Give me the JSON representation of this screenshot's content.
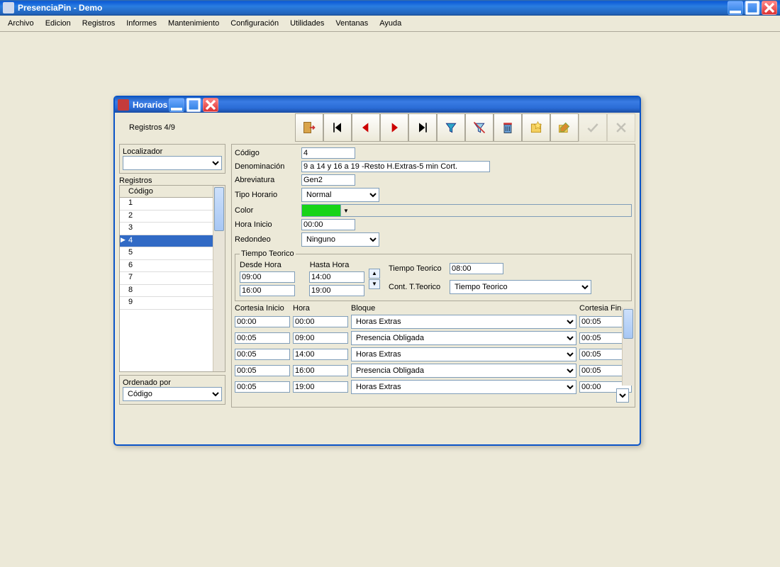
{
  "app": {
    "title": "PresenciaPin - Demo"
  },
  "menubar": [
    "Archivo",
    "Edicion",
    "Registros",
    "Informes",
    "Mantenimiento",
    "Configuración",
    "Utilidades",
    "Ventanas",
    "Ayuda"
  ],
  "dialog": {
    "title": "Horarios",
    "record_counter": "Registros 4/9",
    "toolbar": [
      {
        "name": "exit-icon",
        "title": "Salir"
      },
      {
        "name": "first-icon",
        "title": "Primero"
      },
      {
        "name": "prev-icon",
        "title": "Anterior"
      },
      {
        "name": "next-icon",
        "title": "Siguiente"
      },
      {
        "name": "last-icon",
        "title": "Último"
      },
      {
        "name": "filter-icon",
        "title": "Filtro"
      },
      {
        "name": "clear-filter-icon",
        "title": "Quitar filtro"
      },
      {
        "name": "delete-icon",
        "title": "Eliminar"
      },
      {
        "name": "new-icon",
        "title": "Nuevo"
      },
      {
        "name": "edit-icon",
        "title": "Editar"
      },
      {
        "name": "confirm-icon",
        "title": "Confirmar",
        "disabled": true
      },
      {
        "name": "cancel-icon",
        "title": "Cancelar",
        "disabled": true
      }
    ],
    "left": {
      "localizador_label": "Localizador",
      "localizador_value": "",
      "registros_label": "Registros",
      "list_header": "Código",
      "rows": [
        "1",
        "2",
        "3",
        "4",
        "5",
        "6",
        "7",
        "8",
        "9"
      ],
      "selected": "4",
      "ordenado_label": "Ordenado por",
      "ordenado_value": "Código"
    },
    "form": {
      "codigo_label": "Código",
      "codigo": "4",
      "denominacion_label": "Denominación",
      "denominacion": "9 a 14 y 16 a 19 -Resto H.Extras-5 min Cort.",
      "abrev_label": "Abreviatura",
      "abrev": "Gen2",
      "tipo_label": "Tipo Horario",
      "tipo": "Normal",
      "color_label": "Color",
      "color": "#17d417",
      "hora_inicio_label": "Hora Inicio",
      "hora_inicio": "00:00",
      "redondeo_label": "Redondeo",
      "redondeo": "Ninguno"
    },
    "tiempo": {
      "legend": "Tiempo Teorico",
      "desde_label": "Desde Hora",
      "hasta_label": "Hasta Hora",
      "rows": [
        [
          "09:00",
          "14:00"
        ],
        [
          "16:00",
          "19:00"
        ]
      ],
      "tt_label": "Tiempo Teorico",
      "tt_value": "08:00",
      "cont_label": "Cont. T.Teorico",
      "cont_value": "Tiempo Teorico"
    },
    "table": {
      "headers": [
        "Cortesia Inicio",
        "Hora",
        "Bloque",
        "Cortesia Fin"
      ],
      "rows": [
        {
          "ci": "00:00",
          "hora": "00:00",
          "bloque": "Horas Extras",
          "cf": "00:05"
        },
        {
          "ci": "00:05",
          "hora": "09:00",
          "bloque": "Presencia Obligada",
          "cf": "00:05"
        },
        {
          "ci": "00:05",
          "hora": "14:00",
          "bloque": "Horas Extras",
          "cf": "00:05"
        },
        {
          "ci": "00:05",
          "hora": "16:00",
          "bloque": "Presencia Obligada",
          "cf": "00:05"
        },
        {
          "ci": "00:05",
          "hora": "19:00",
          "bloque": "Horas Extras",
          "cf": "00:00"
        }
      ]
    }
  }
}
